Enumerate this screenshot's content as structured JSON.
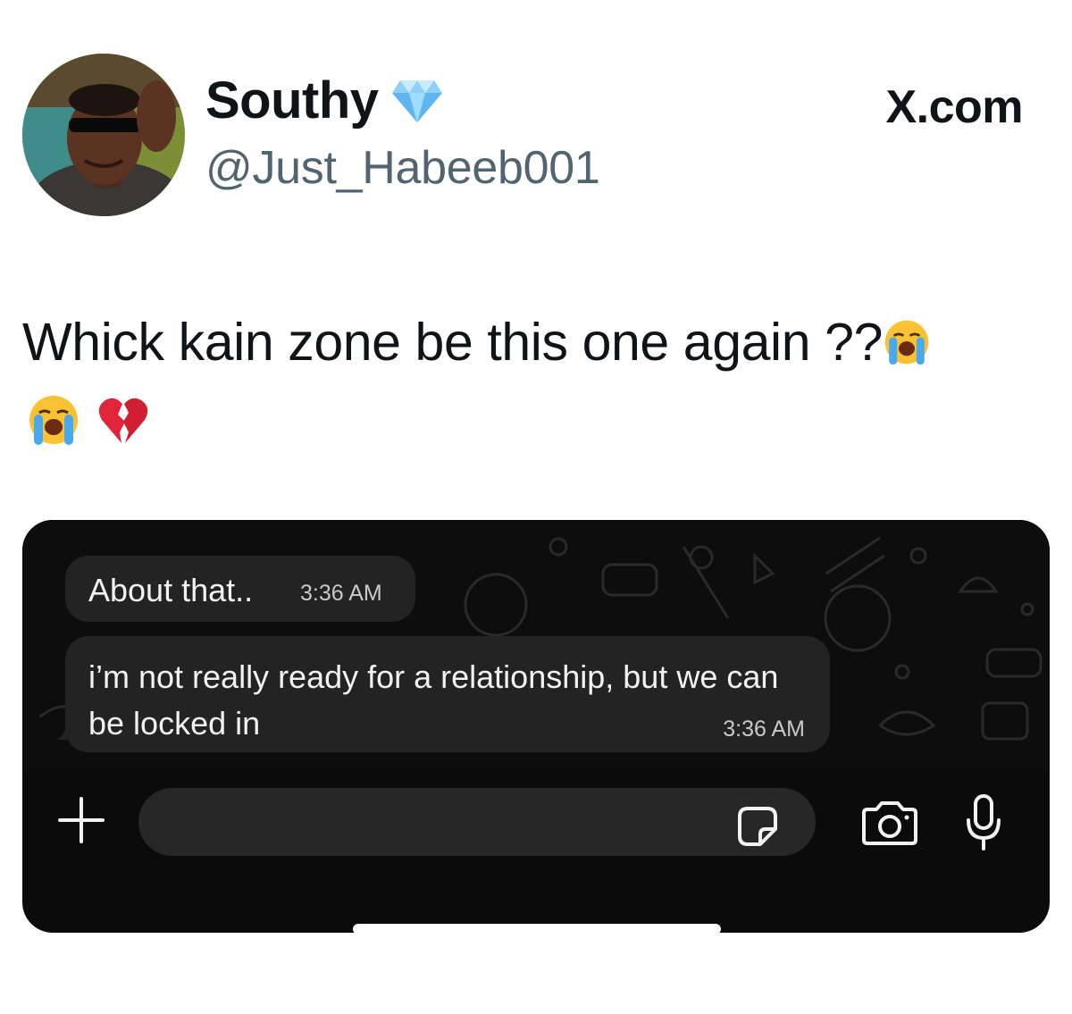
{
  "header": {
    "display_name": "Southy",
    "handle": "@Just_Habeeb001",
    "brand": "X.com",
    "verified_icon": "diamond-badge-icon",
    "avatar": "avatar-photo"
  },
  "tweet": {
    "text": "Whick kain zone be this one again ??",
    "emojis": [
      "loudly-crying-face",
      "loudly-crying-face",
      "broken-heart"
    ]
  },
  "chat_screenshot": {
    "messages": [
      {
        "text": "About that..",
        "time": "3:36 AM"
      },
      {
        "text": "i’m not really ready for a relationship, but we can be locked in",
        "time": "3:36 AM"
      }
    ],
    "input_bar": {
      "icons": [
        "plus-icon",
        "sticker-icon",
        "camera-icon",
        "microphone-icon"
      ]
    },
    "colors": {
      "background": "#0b0b0b",
      "bubble": "#232323",
      "text": "#f2f2f2"
    }
  }
}
